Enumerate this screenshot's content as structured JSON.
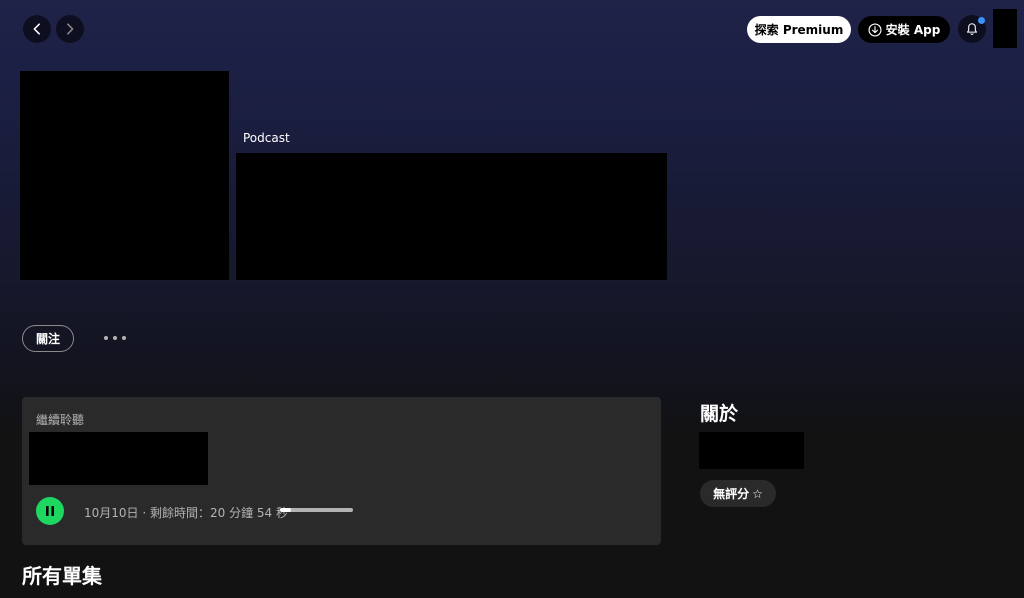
{
  "topbar": {
    "premium_label": "探索 Premium",
    "install_label": "安裝 App",
    "accent_dot_color": "#3d91f4"
  },
  "header": {
    "type_label": "Podcast"
  },
  "actions": {
    "follow_label": "關注"
  },
  "continue_listening": {
    "label": "繼續聆聽",
    "meta": "10月10日 · 剩餘時間：20 分鐘 54 秒",
    "progress": 0.15,
    "play_color": "#1ed760"
  },
  "about": {
    "title": "關於",
    "rating_label": "無評分",
    "rating_icon": "☆"
  },
  "episodes": {
    "title": "所有單集"
  },
  "icons": [
    "chevron-left-icon",
    "chevron-right-icon",
    "download-icon",
    "bell-icon",
    "more-dots-icon",
    "pause-icon",
    "star-icon"
  ]
}
